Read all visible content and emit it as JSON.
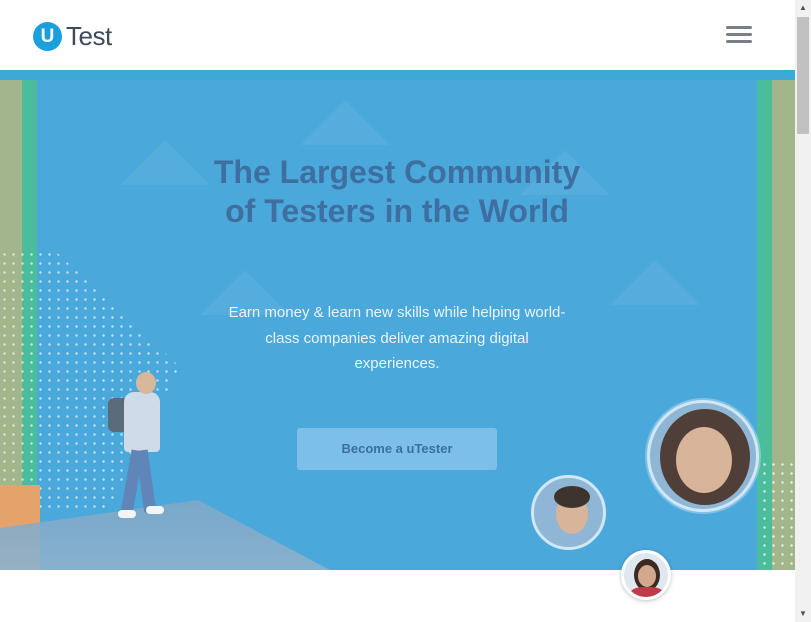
{
  "header": {
    "logo_mark": "U",
    "logo_text": "Test",
    "menu_icon": "hamburger-menu-icon"
  },
  "hero": {
    "title": "The Largest Community of Testers in the World",
    "subtitle": "Earn money & learn new skills while helping world-class companies deliver amazing digital experiences.",
    "cta_label": "Become a uTester"
  },
  "colors": {
    "brand_blue": "#1aa0dc",
    "hero_background": "#4aa8da",
    "title_color": "#3f6ea0",
    "cta_background": "#7cc0e8"
  },
  "scrollbar": {
    "up_icon": "▲",
    "down_icon": "▼"
  }
}
